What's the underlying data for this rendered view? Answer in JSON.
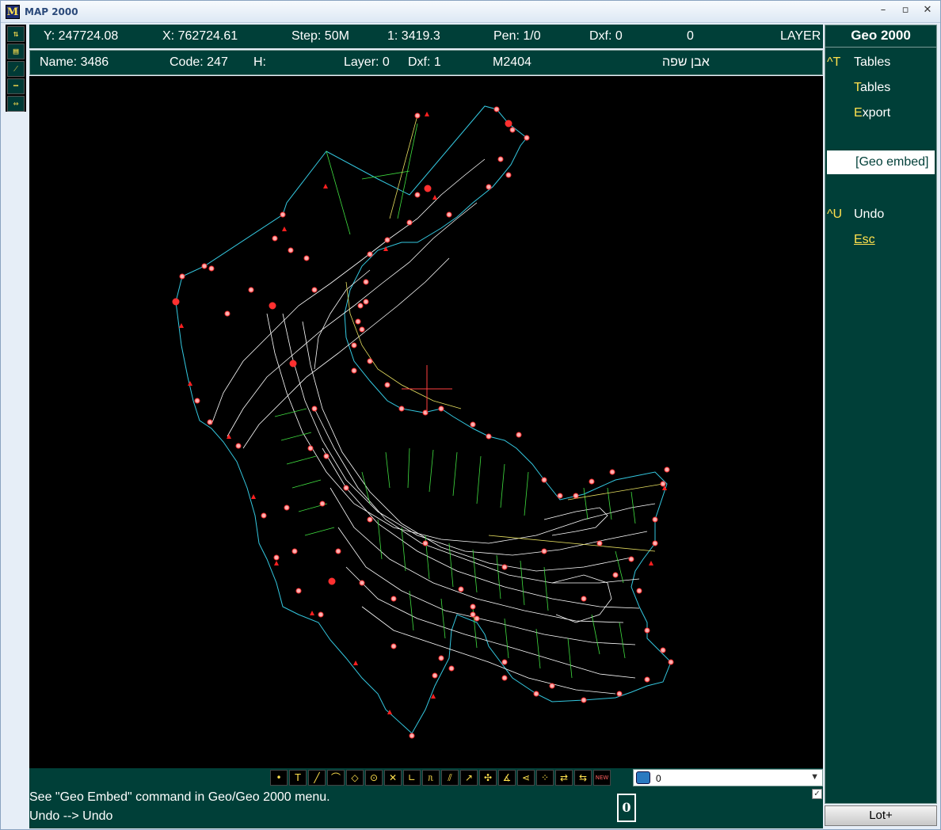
{
  "window": {
    "title": "MAP 2000",
    "app_icon_letter": "M"
  },
  "status_line_1": {
    "y": "Y: 247724.08",
    "x": "X: 762724.61",
    "step": "Step: 50M",
    "scale": "1: 3419.3",
    "pen": "Pen: 1/0",
    "dxf": "Dxf: 0",
    "count": "0",
    "mode": "LAYER"
  },
  "status_line_2": {
    "name": "Name:  3486",
    "code": "Code:  247",
    "h": "H:",
    "layer": "Layer:  0",
    "dxf": "Dxf:  1",
    "map_id": "M2404",
    "place": "אבן שפה"
  },
  "right_panel": {
    "title": "Geo 2000",
    "items": [
      {
        "key": "^T",
        "pre": "",
        "hot": "",
        "rest": "Tables"
      },
      {
        "key": "",
        "pre": "",
        "hot": "T",
        "rest": "ables"
      },
      {
        "key": "",
        "pre": "",
        "hot": "E",
        "rest": "xport"
      },
      {
        "key": "",
        "pre": "",
        "hot": "",
        "rest": "[Geo embed]"
      },
      {
        "key": "^U",
        "pre": "",
        "hot": "",
        "rest": "Undo"
      },
      {
        "key": "",
        "pre": "",
        "hot": "",
        "rest": "Esc"
      }
    ],
    "lot_button": "Lot+"
  },
  "bottom": {
    "message_1": "See \"Geo Embed\" command in Geo/Geo 2000 menu.",
    "message_2": "Undo --> Undo",
    "layer_value": "0",
    "counter": "0",
    "tools": [
      "point-tool",
      "text-tool",
      "line-tool",
      "arc-tool",
      "diamond-tool",
      "circle-tool",
      "cross-tool",
      "corner-tool",
      "gate-tool",
      "parallel-tool",
      "arrow-tool",
      "move-tool",
      "angle-tool",
      "snap-tool",
      "grid-tool",
      "join-tool",
      "split-tool",
      "new-tool"
    ],
    "tool_glyphs": [
      "•",
      "T",
      "╱",
      "⌒",
      "◇",
      "⊙",
      "✕",
      "∟",
      "ᥰ",
      "⫽",
      "↗",
      "✣",
      "∡",
      "⋖",
      "⁘",
      "⇄",
      "⇆",
      "NEW"
    ]
  },
  "colors": {
    "panel_bg": "#003f38",
    "canvas_bg": "#000000",
    "accent_yellow": "#ffe14d",
    "boundary_cyan": "#34c8e0",
    "contour_white": "#ffffff",
    "node_red": "#ff4040",
    "grid_green": "#40e040",
    "road_yellow": "#e8e060"
  }
}
